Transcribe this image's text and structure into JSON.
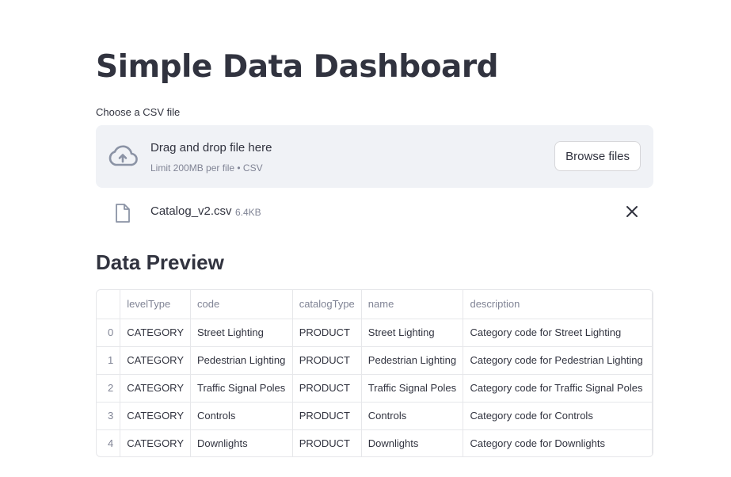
{
  "page": {
    "title": "Simple Data Dashboard"
  },
  "uploader": {
    "label": "Choose a CSV file",
    "drop_title": "Drag and drop file here",
    "drop_limit": "Limit 200MB per file • CSV",
    "browse_label": "Browse files",
    "icon": "cloud-upload-icon"
  },
  "file": {
    "name": "Catalog_v2.csv",
    "size": "6.4KB",
    "icon": "file-icon",
    "remove_icon": "close-icon"
  },
  "preview": {
    "heading": "Data Preview",
    "columns": [
      "",
      "levelType",
      "code",
      "catalogType",
      "name",
      "description"
    ],
    "rows": [
      [
        "0",
        "CATEGORY",
        "Street Lighting",
        "PRODUCT",
        "Street Lighting",
        "Category code for Street Lighting"
      ],
      [
        "1",
        "CATEGORY",
        "Pedestrian Lighting",
        "PRODUCT",
        "Pedestrian Lighting",
        "Category code for Pedestrian Lighting"
      ],
      [
        "2",
        "CATEGORY",
        "Traffic Signal Poles",
        "PRODUCT",
        "Traffic Signal Poles",
        "Category code for Traffic Signal Poles"
      ],
      [
        "3",
        "CATEGORY",
        "Controls",
        "PRODUCT",
        "Controls",
        "Category code for Controls"
      ],
      [
        "4",
        "CATEGORY",
        "Downlights",
        "PRODUCT",
        "Downlights",
        "Category code for Downlights"
      ]
    ]
  },
  "colors": {
    "text": "#31333f",
    "muted": "#808495",
    "dropzone_bg": "#f0f2f6",
    "border": "#e6e7ea"
  }
}
